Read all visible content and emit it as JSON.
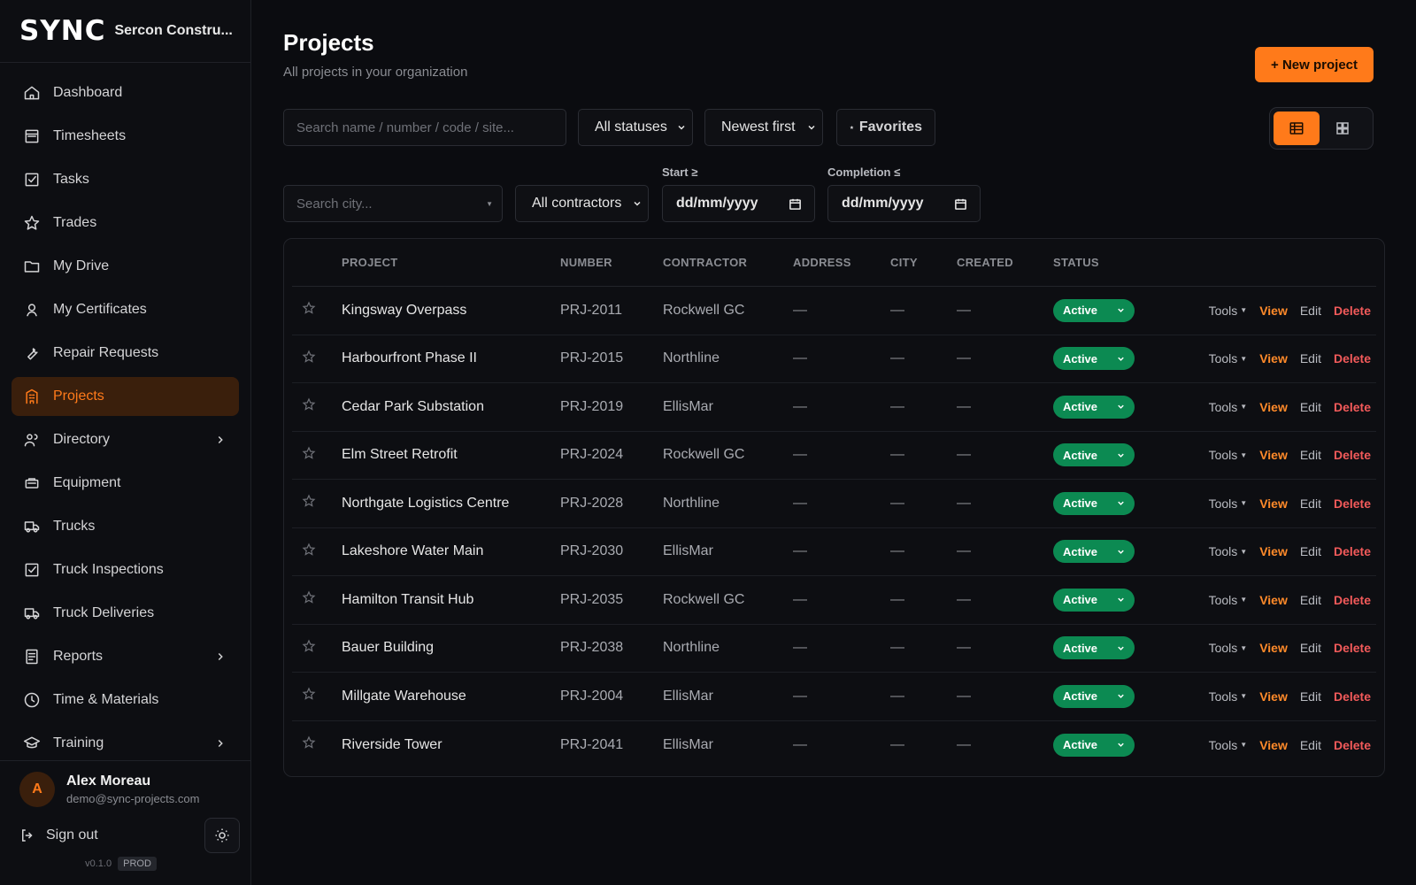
{
  "brand": {
    "logo": "SYNC",
    "org": "Sercon Constru..."
  },
  "nav": [
    {
      "label": "Dashboard",
      "icon": "home-icon"
    },
    {
      "label": "Timesheets",
      "icon": "timesheet-icon"
    },
    {
      "label": "Tasks",
      "icon": "check-square-icon"
    },
    {
      "label": "Trades",
      "icon": "star-icon"
    },
    {
      "label": "My Drive",
      "icon": "folder-icon"
    },
    {
      "label": "My Certificates",
      "icon": "certificate-icon"
    },
    {
      "label": "Repair Requests",
      "icon": "wrench-icon"
    },
    {
      "label": "Projects",
      "icon": "building-icon",
      "active": true
    },
    {
      "label": "Directory",
      "icon": "users-icon",
      "expandable": true
    },
    {
      "label": "Equipment",
      "icon": "equipment-icon"
    },
    {
      "label": "Trucks",
      "icon": "truck-icon"
    },
    {
      "label": "Truck Inspections",
      "icon": "check-square-icon"
    },
    {
      "label": "Truck Deliveries",
      "icon": "truck-icon"
    },
    {
      "label": "Reports",
      "icon": "report-icon",
      "expandable": true
    },
    {
      "label": "Time & Materials",
      "icon": "clock-icon"
    },
    {
      "label": "Training",
      "icon": "graduation-cap-icon",
      "expandable": true
    }
  ],
  "user": {
    "initial": "A",
    "name": "Alex Moreau",
    "email": "demo@sync-projects.com"
  },
  "footer": {
    "signout": "Sign out",
    "version": "v0.1.0",
    "env": "PROD"
  },
  "page": {
    "title": "Projects",
    "subtitle": "All projects in your organization",
    "new_button": "+ New project"
  },
  "filters": {
    "search_placeholder": "Search name / number / code / site...",
    "status": "All statuses",
    "sort": "Newest first",
    "favorites": "Favorites",
    "city_placeholder": "Search city...",
    "contractors": "All contractors",
    "start_label": "Start ≥",
    "start_value": "dd/mm/yyyy",
    "completion_label": "Completion ≤",
    "completion_value": "dd/mm/yyyy"
  },
  "table": {
    "headers": {
      "project": "PROJECT",
      "number": "NUMBER",
      "contractor": "CONTRACTOR",
      "address": "ADDRESS",
      "city": "CITY",
      "created": "CREATED",
      "status": "STATUS"
    },
    "actions": {
      "tools": "Tools",
      "view": "View",
      "edit": "Edit",
      "delete": "Delete"
    },
    "rows": [
      {
        "project": "Kingsway Overpass",
        "number": "PRJ-2011",
        "contractor": "Rockwell GC",
        "address": "—",
        "city": "—",
        "created": "—",
        "status": "Active"
      },
      {
        "project": "Harbourfront Phase II",
        "number": "PRJ-2015",
        "contractor": "Northline",
        "address": "—",
        "city": "—",
        "created": "—",
        "status": "Active"
      },
      {
        "project": "Cedar Park Substation",
        "number": "PRJ-2019",
        "contractor": "EllisMar",
        "address": "—",
        "city": "—",
        "created": "—",
        "status": "Active"
      },
      {
        "project": "Elm Street Retrofit",
        "number": "PRJ-2024",
        "contractor": "Rockwell GC",
        "address": "—",
        "city": "—",
        "created": "—",
        "status": "Active"
      },
      {
        "project": "Northgate Logistics Centre",
        "number": "PRJ-2028",
        "contractor": "Northline",
        "address": "—",
        "city": "—",
        "created": "—",
        "status": "Active"
      },
      {
        "project": "Lakeshore Water Main",
        "number": "PRJ-2030",
        "contractor": "EllisMar",
        "address": "—",
        "city": "—",
        "created": "—",
        "status": "Active"
      },
      {
        "project": "Hamilton Transit Hub",
        "number": "PRJ-2035",
        "contractor": "Rockwell GC",
        "address": "—",
        "city": "—",
        "created": "—",
        "status": "Active"
      },
      {
        "project": "Bauer Building",
        "number": "PRJ-2038",
        "contractor": "Northline",
        "address": "—",
        "city": "—",
        "created": "—",
        "status": "Active"
      },
      {
        "project": "Millgate Warehouse",
        "number": "PRJ-2004",
        "contractor": "EllisMar",
        "address": "—",
        "city": "—",
        "created": "—",
        "status": "Active"
      },
      {
        "project": "Riverside Tower",
        "number": "PRJ-2041",
        "contractor": "EllisMar",
        "address": "—",
        "city": "—",
        "created": "—",
        "status": "Active"
      }
    ]
  },
  "colors": {
    "accent": "#ff7a1a",
    "active_status": "#0c8a52",
    "delete": "#f25a5a",
    "background": "#0b0c10"
  }
}
